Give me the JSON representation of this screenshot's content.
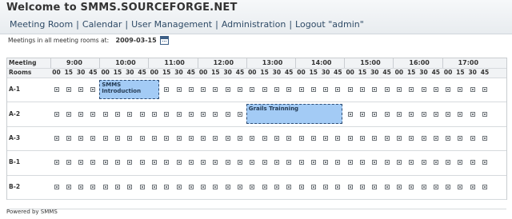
{
  "header": {
    "title": "Welcome to SMMS.SOURCEFORGE.NET",
    "nav": [
      "Meeting Room",
      "Calendar",
      "User Management",
      "Administration",
      "Logout \"admin\""
    ]
  },
  "datebar": {
    "label": "Meetings in all meeting rooms at:",
    "date": "2009-03-15",
    "icon": "calendar-icon"
  },
  "schedule": {
    "header_top": "Meeting",
    "header_bottom": "Rooms",
    "hours": [
      "9:00",
      "10:00",
      "11:00",
      "12:00",
      "13:00",
      "14:00",
      "15:00",
      "16:00",
      "17:00"
    ],
    "minutes": [
      "00",
      "15",
      "30",
      "45"
    ],
    "rooms": [
      "A-1",
      "A-2",
      "A-3",
      "B-1",
      "B-2"
    ],
    "meetings": [
      {
        "room": "A-1",
        "title": "SMMS Introduction",
        "start": "10:00",
        "end": "11:00"
      },
      {
        "room": "A-2",
        "title": "Grails Trainning",
        "start": "13:00",
        "end": "14:45"
      }
    ]
  },
  "footer": {
    "text": "Powered by SMMS"
  }
}
